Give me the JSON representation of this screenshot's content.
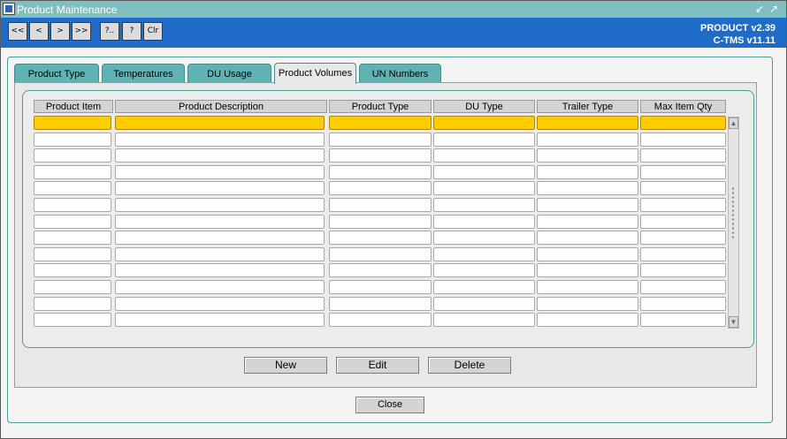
{
  "window": {
    "title": "Product Maintenance",
    "minimize_glyph": "↙",
    "maximize_glyph": "↗"
  },
  "toolbar": {
    "first_label": "<<",
    "prev_label": "<",
    "next_label": ">",
    "last_label": ">>",
    "query_label": "?..",
    "help_label": "?",
    "clear_label": "Clr",
    "version_line1": "PRODUCT v2.39",
    "version_line2": "C-TMS v11.11"
  },
  "tabs": [
    {
      "label": "Product Type",
      "active": false
    },
    {
      "label": "Temperatures",
      "active": false
    },
    {
      "label": "DU Usage",
      "active": false
    },
    {
      "label": "Product Volumes",
      "active": true
    },
    {
      "label": "UN Numbers",
      "active": false
    }
  ],
  "table": {
    "columns": [
      "Product Item",
      "Product Description",
      "Product Type",
      "DU Type",
      "Trailer Type",
      "Max Item Qty"
    ],
    "selected_row": 0,
    "rows": [
      [
        "",
        "",
        "",
        "",
        "",
        ""
      ],
      [
        "",
        "",
        "",
        "",
        "",
        ""
      ],
      [
        "",
        "",
        "",
        "",
        "",
        ""
      ],
      [
        "",
        "",
        "",
        "",
        "",
        ""
      ],
      [
        "",
        "",
        "",
        "",
        "",
        ""
      ],
      [
        "",
        "",
        "",
        "",
        "",
        ""
      ],
      [
        "",
        "",
        "",
        "",
        "",
        ""
      ],
      [
        "",
        "",
        "",
        "",
        "",
        ""
      ],
      [
        "",
        "",
        "",
        "",
        "",
        ""
      ],
      [
        "",
        "",
        "",
        "",
        "",
        ""
      ],
      [
        "",
        "",
        "",
        "",
        "",
        ""
      ],
      [
        "",
        "",
        "",
        "",
        "",
        ""
      ],
      [
        "",
        "",
        "",
        "",
        "",
        ""
      ]
    ]
  },
  "scrollbar": {
    "up_glyph": "▲",
    "down_glyph": "▼"
  },
  "actions": {
    "new_label": "New",
    "edit_label": "Edit",
    "delete_label": "Delete",
    "close_label": "Close"
  },
  "colors": {
    "titlebar": "#7fbfbf",
    "toolbar": "#1e6cc8",
    "tab": "#60b3b3",
    "selected_row": "#ffcc00"
  }
}
